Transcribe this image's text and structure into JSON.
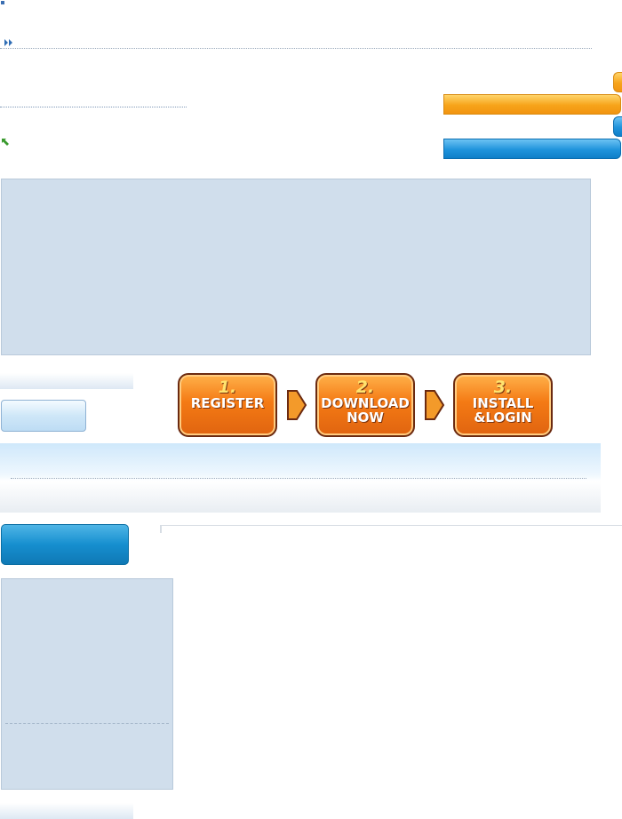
{
  "steps": [
    {
      "num": "1.",
      "label": "REGISTER"
    },
    {
      "num": "2.",
      "label": "DOWNLOAD NOW"
    },
    {
      "num": "3.",
      "label": "INSTALL &LOGIN"
    }
  ],
  "icons": {
    "top_bullet": "dot-icon",
    "nav_bullet": "double-arrow-icon",
    "link_icon": "green-arrow-icon",
    "step_arrow": "orange-arrow-icon"
  },
  "colors": {
    "panel_bg": "#d0deec",
    "orange_accent": "#f7a41a",
    "blue_accent": "#1f93dc",
    "step_orange": "#f47a14"
  }
}
